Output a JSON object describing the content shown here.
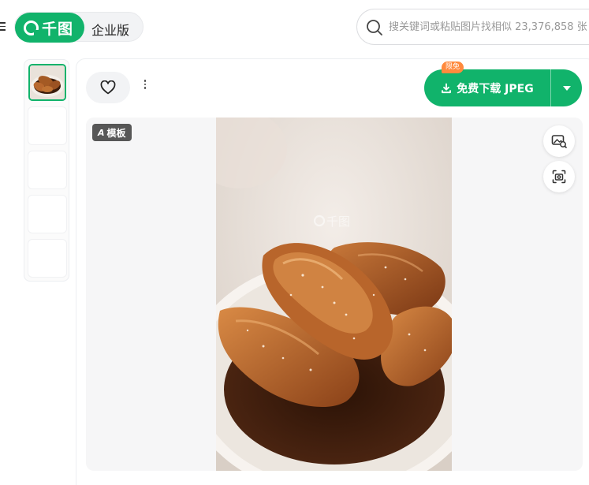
{
  "header": {
    "logo_text": "千图",
    "edition": "企业版",
    "search": {
      "placeholder": "搜关键词或粘贴图片找相似 23,376,858 张"
    }
  },
  "thumbnails": {
    "count": 5,
    "active_index": 0
  },
  "toolbar": {
    "favorite_icon": "heart-icon",
    "more_icon": "more-vertical-icon",
    "download_label": "免费下载 JPEG",
    "download_icon": "download-icon",
    "dropdown_icon": "caret-down-icon",
    "free_badge": "限免"
  },
  "preview": {
    "template_badge": "模板",
    "template_badge_prefix": "A",
    "watermark_text": "千图",
    "tools": [
      "image-search-icon",
      "camera-scan-icon"
    ]
  },
  "colors": {
    "brand_green": "#11b36b",
    "badge_orange": "#ff8a3d"
  }
}
